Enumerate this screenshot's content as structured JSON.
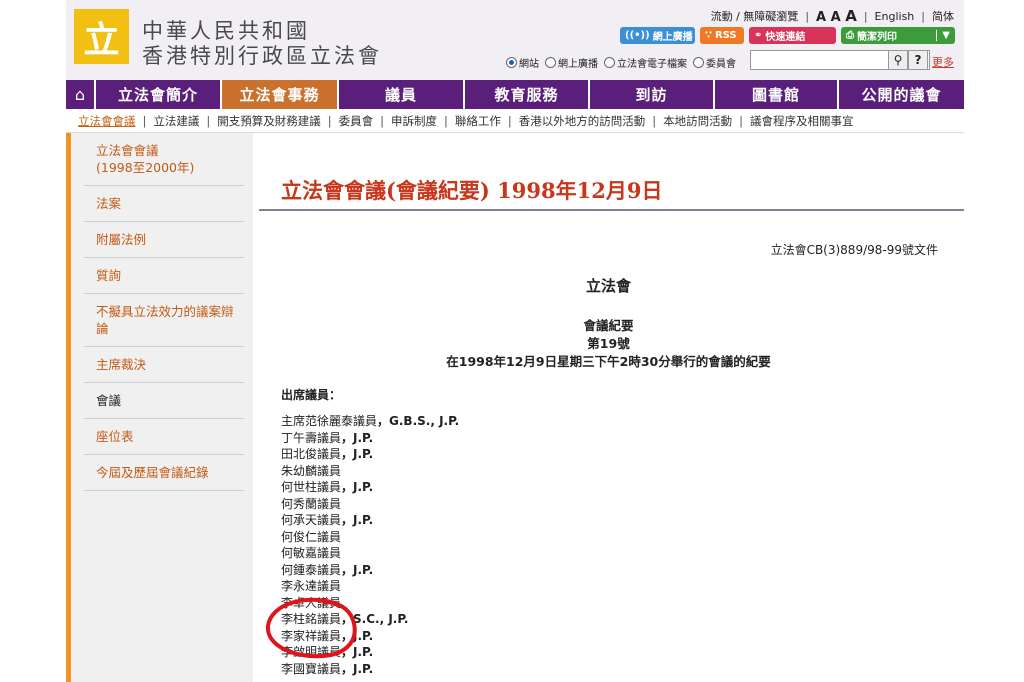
{
  "header": {
    "logo_glyph": "立",
    "title_line1": "中華人民共和國",
    "title_line2": "香港特別行政區立法會",
    "toplinks": {
      "mobile": "流動 / 無障礙瀏覽",
      "font_small": "A",
      "font_mid": "A",
      "font_large": "A",
      "english": "English",
      "simplified": "简体"
    },
    "buttons": {
      "webcast": "網上廣播",
      "rss": "RSS",
      "quicklinks": "快速連結",
      "print": "簡潔列印",
      "print_dropdown": "▼"
    },
    "search": {
      "radios": [
        "網站",
        "網上廣播",
        "立法會電子檔案",
        "委員會"
      ],
      "selected_radio": "網站",
      "search_icon": "search-icon",
      "help_label": "?",
      "more": "更多"
    }
  },
  "nav": {
    "home_icon": "home-icon",
    "items": [
      "立法會簡介",
      "立法會事務",
      "議員",
      "教育服務",
      "到訪",
      "圖書館",
      "公開的議會"
    ],
    "active": "立法會事務"
  },
  "subnav": {
    "items": [
      "立法會會議",
      "立法建議",
      "開支預算及財務建議",
      "委員會",
      "申訴制度",
      "聯絡工作",
      "香港以外地方的訪問活動",
      "本地訪問活動",
      "議會程序及相關事宜"
    ],
    "active": "立法會會議"
  },
  "sidebar": {
    "items": [
      "立法會會議\n(1998至2000年)",
      "法案",
      "附屬法例",
      "質詢",
      "不擬具立法效力的議案辯論",
      "主席裁決",
      "會議",
      "座位表",
      "今屆及歷屆會議紀錄"
    ],
    "current": "會議"
  },
  "main": {
    "title": "立法會會議(會議紀要) 1998年12月9日",
    "doc_no": "立法會CB(3)889/98-99號文件",
    "heading1": "立法會",
    "heading2": "會議紀要",
    "heading3": "第19號",
    "heading4": "在1998年12月9日星期三下午2時30分舉行的會議的紀要",
    "attendance_label": "出席議員：",
    "members": [
      {
        "name": "主席范徐麗泰議員",
        "suffix": "，G.B.S., J.P."
      },
      {
        "name": "丁午壽議員",
        "suffix": "，J.P."
      },
      {
        "name": "田北俊議員",
        "suffix": "，J.P."
      },
      {
        "name": "朱幼麟議員",
        "suffix": ""
      },
      {
        "name": "何世柱議員",
        "suffix": "，J.P."
      },
      {
        "name": "何秀蘭議員",
        "suffix": ""
      },
      {
        "name": "何承天議員",
        "suffix": "，J.P."
      },
      {
        "name": "何俊仁議員",
        "suffix": ""
      },
      {
        "name": "何敏嘉議員",
        "suffix": ""
      },
      {
        "name": "何鍾泰議員",
        "suffix": "，J.P."
      },
      {
        "name": "李永達議員",
        "suffix": ""
      },
      {
        "name": "李卓人議員",
        "suffix": ""
      },
      {
        "name": "李柱銘議員",
        "suffix": "，S.C., J.P."
      },
      {
        "name": "李家祥議員",
        "suffix": "，J.P."
      },
      {
        "name": "李啟明議員",
        "suffix": "，J.P."
      },
      {
        "name": "李國寶議員",
        "suffix": "，J.P."
      }
    ],
    "highlight_color": "#e0151c"
  }
}
